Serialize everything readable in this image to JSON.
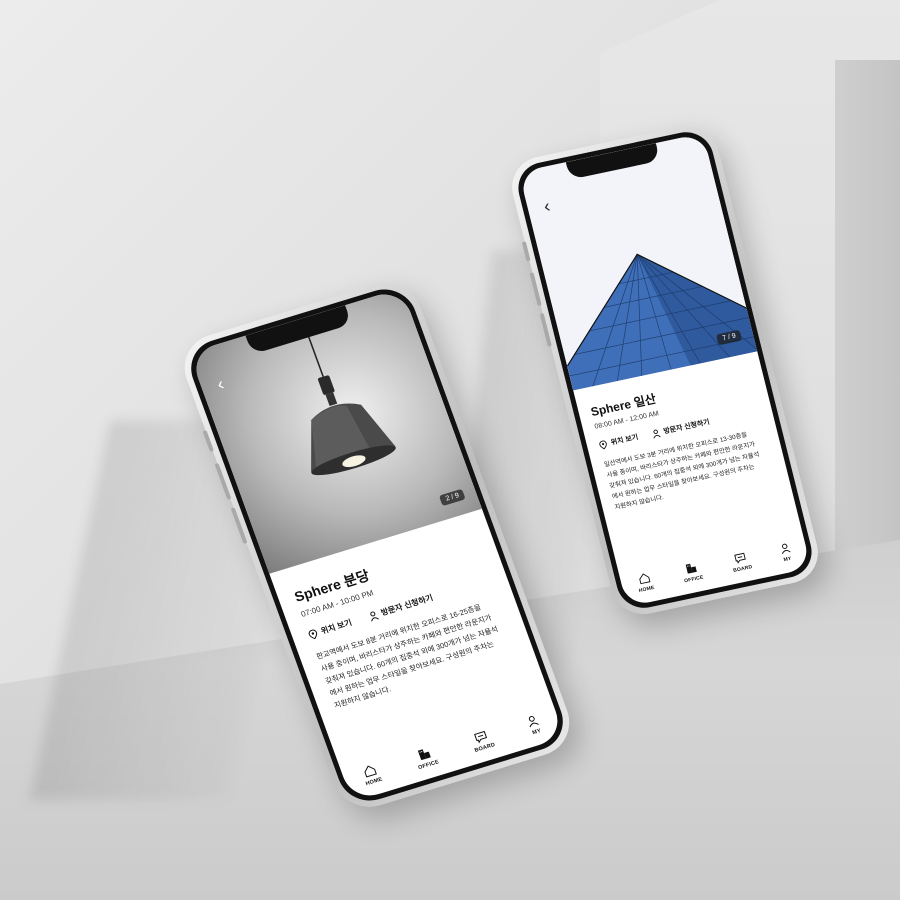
{
  "phones": [
    {
      "back_icon": "‹",
      "image_counter": "2 / 9",
      "title": "Sphere 분당",
      "hours": "07:00 AM - 10:00 PM",
      "location_label": "위치 보기",
      "visitor_label": "방문자 신청하기",
      "description_lines": [
        "판교역에서 도보 8분 거리에 위치한 오피스로 16-25층을",
        "사용 중이며, 바리스타가 상주하는 카페와 편안한 라운지가",
        "갖춰져 있습니다. 60개의 집중석 외에 300개가 넘는 자율석",
        "에서 원하는 업무 스타일을 찾아보세요. 구성원의 주차는",
        "지원하지 않습니다."
      ],
      "tabs": [
        {
          "label": "HOME",
          "icon": "home-icon"
        },
        {
          "label": "OFFICE",
          "icon": "office-icon"
        },
        {
          "label": "BOARD",
          "icon": "board-icon"
        },
        {
          "label": "MY",
          "icon": "person-icon"
        }
      ]
    },
    {
      "back_icon": "‹",
      "image_counter": "7 / 9",
      "title": "Sphere 일산",
      "hours": "08:00 AM - 12:00 AM",
      "location_label": "위치 보기",
      "visitor_label": "방문자 신청하기",
      "description_lines": [
        "일산역에서 도보 3분 거리에 위치한 오피스로 13-30층을",
        "사용 중이며, 바리스타가 상주하는 카페와 편안한 라운지가",
        "갖춰져 있습니다. 60개의 집중석 외에 300개가 넘는 자율석",
        "에서 원하는 업무 스타일을 찾아보세요. 구성원의 주차는",
        "지원하지 않습니다."
      ],
      "tabs": [
        {
          "label": "HOME",
          "icon": "home-icon"
        },
        {
          "label": "OFFICE",
          "icon": "office-icon"
        },
        {
          "label": "BOARD",
          "icon": "board-icon"
        },
        {
          "label": "MY",
          "icon": "person-icon"
        }
      ]
    }
  ],
  "colors": {
    "building_blue": "#3f6fb8",
    "text_dark": "#111111"
  }
}
